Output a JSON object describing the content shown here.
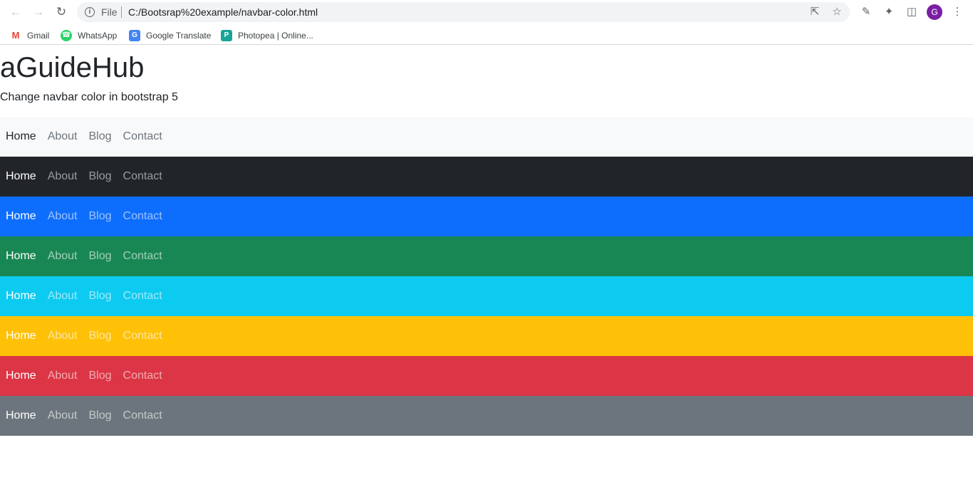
{
  "browser": {
    "omnibox": {
      "scheme_label": "File",
      "url": "C:/Bootsrap%20example/navbar-color.html"
    },
    "profile_initial": "G",
    "bookmarks": [
      {
        "label": "Gmail"
      },
      {
        "label": "WhatsApp"
      },
      {
        "label": "Google Translate"
      },
      {
        "label": "Photopea | Online..."
      }
    ]
  },
  "page": {
    "title": "aGuideHub",
    "subtitle": "Change navbar color in bootstrap 5"
  },
  "navbars": [
    {
      "bg": "#f8f9fa",
      "active": "#212529",
      "inactive": "#6c757d",
      "links": [
        "Home",
        "About",
        "Blog",
        "Contact"
      ]
    },
    {
      "bg": "#212529",
      "active": "#ffffff",
      "inactive": "#9a9da0",
      "links": [
        "Home",
        "About",
        "Blog",
        "Contact"
      ]
    },
    {
      "bg": "#0d6efd",
      "active": "#ffffff",
      "inactive": "#9fc3fe",
      "links": [
        "Home",
        "About",
        "Blog",
        "Contact"
      ]
    },
    {
      "bg": "#198754",
      "active": "#ffffff",
      "inactive": "#a3cfba",
      "links": [
        "Home",
        "About",
        "Blog",
        "Contact"
      ]
    },
    {
      "bg": "#0dcaf0",
      "active": "#ffffff",
      "inactive": "#9fe9f9",
      "links": [
        "Home",
        "About",
        "Blog",
        "Contact"
      ]
    },
    {
      "bg": "#ffc107",
      "active": "#ffffff",
      "inactive": "#ffe59c",
      "links": [
        "Home",
        "About",
        "Blog",
        "Contact"
      ]
    },
    {
      "bg": "#dc3545",
      "active": "#ffffff",
      "inactive": "#f1acb3",
      "links": [
        "Home",
        "About",
        "Blog",
        "Contact"
      ]
    },
    {
      "bg": "#6c757d",
      "active": "#ffffff",
      "inactive": "#c5c9cc",
      "links": [
        "Home",
        "About",
        "Blog",
        "Contact"
      ]
    }
  ]
}
